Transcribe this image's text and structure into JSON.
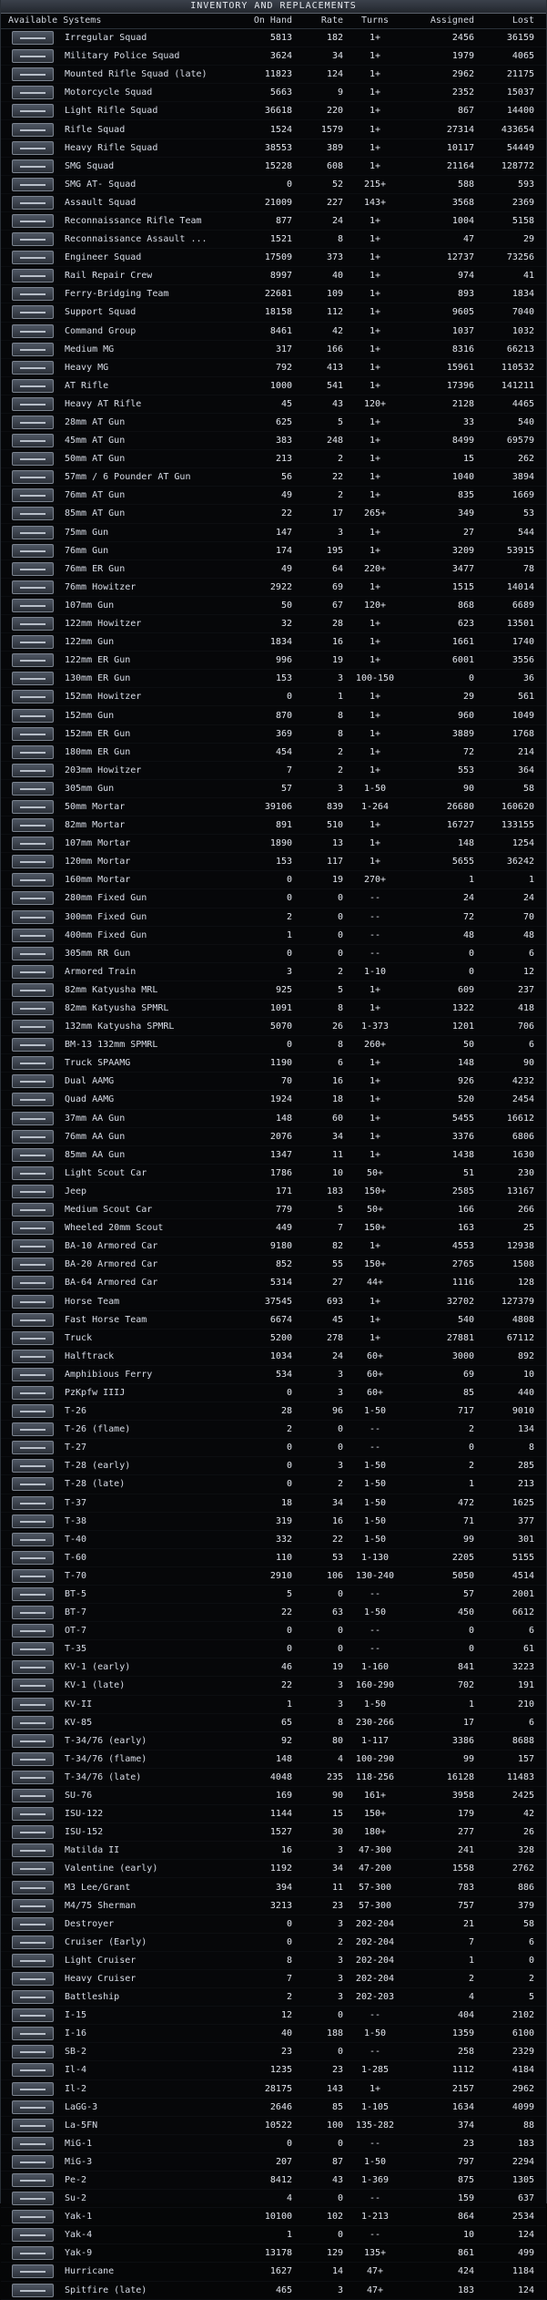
{
  "window": {
    "title": "INVENTORY AND REPLACEMENTS"
  },
  "header": {
    "systems": "Available Systems",
    "on_hand": "On Hand",
    "rate": "Rate",
    "turns": "Turns",
    "assigned": "Assigned",
    "lost": "Lost"
  },
  "rows": [
    {
      "name": "Irregular Squad",
      "on_hand": "5813",
      "rate": "182",
      "turns": "1+",
      "assigned": "2456",
      "lost": "36159"
    },
    {
      "name": "Military Police Squad",
      "on_hand": "3624",
      "rate": "34",
      "turns": "1+",
      "assigned": "1979",
      "lost": "4065"
    },
    {
      "name": "Mounted Rifle Squad (late)",
      "on_hand": "11823",
      "rate": "124",
      "turns": "1+",
      "assigned": "2962",
      "lost": "21175"
    },
    {
      "name": "Motorcycle Squad",
      "on_hand": "5663",
      "rate": "9",
      "turns": "1+",
      "assigned": "2352",
      "lost": "15037"
    },
    {
      "name": "Light Rifle Squad",
      "on_hand": "36618",
      "rate": "220",
      "turns": "1+",
      "assigned": "867",
      "lost": "14400"
    },
    {
      "name": "Rifle Squad",
      "on_hand": "1524",
      "rate": "1579",
      "turns": "1+",
      "assigned": "27314",
      "lost": "433654"
    },
    {
      "name": "Heavy Rifle Squad",
      "on_hand": "38553",
      "rate": "389",
      "turns": "1+",
      "assigned": "10117",
      "lost": "54449"
    },
    {
      "name": "SMG Squad",
      "on_hand": "15228",
      "rate": "608",
      "turns": "1+",
      "assigned": "21164",
      "lost": "128772"
    },
    {
      "name": "SMG AT- Squad",
      "on_hand": "0",
      "rate": "52",
      "turns": "215+",
      "assigned": "588",
      "lost": "593"
    },
    {
      "name": "Assault Squad",
      "on_hand": "21009",
      "rate": "227",
      "turns": "143+",
      "assigned": "3568",
      "lost": "2369"
    },
    {
      "name": "Reconnaissance Rifle Team",
      "on_hand": "877",
      "rate": "24",
      "turns": "1+",
      "assigned": "1004",
      "lost": "5158"
    },
    {
      "name": "Reconnaissance Assault ...",
      "on_hand": "1521",
      "rate": "8",
      "turns": "1+",
      "assigned": "47",
      "lost": "29"
    },
    {
      "name": "Engineer Squad",
      "on_hand": "17509",
      "rate": "373",
      "turns": "1+",
      "assigned": "12737",
      "lost": "73256"
    },
    {
      "name": "Rail Repair Crew",
      "on_hand": "8997",
      "rate": "40",
      "turns": "1+",
      "assigned": "974",
      "lost": "41"
    },
    {
      "name": "Ferry-Bridging Team",
      "on_hand": "22681",
      "rate": "109",
      "turns": "1+",
      "assigned": "893",
      "lost": "1834"
    },
    {
      "name": "Support Squad",
      "on_hand": "18158",
      "rate": "112",
      "turns": "1+",
      "assigned": "9605",
      "lost": "7040"
    },
    {
      "name": "Command Group",
      "on_hand": "8461",
      "rate": "42",
      "turns": "1+",
      "assigned": "1037",
      "lost": "1032"
    },
    {
      "name": "Medium MG",
      "on_hand": "317",
      "rate": "166",
      "turns": "1+",
      "assigned": "8316",
      "lost": "66213"
    },
    {
      "name": "Heavy MG",
      "on_hand": "792",
      "rate": "413",
      "turns": "1+",
      "assigned": "15961",
      "lost": "110532"
    },
    {
      "name": "AT Rifle",
      "on_hand": "1000",
      "rate": "541",
      "turns": "1+",
      "assigned": "17396",
      "lost": "141211"
    },
    {
      "name": "Heavy AT Rifle",
      "on_hand": "45",
      "rate": "43",
      "turns": "120+",
      "assigned": "2128",
      "lost": "4465"
    },
    {
      "name": "28mm AT Gun",
      "on_hand": "625",
      "rate": "5",
      "turns": "1+",
      "assigned": "33",
      "lost": "540"
    },
    {
      "name": "45mm AT Gun",
      "on_hand": "383",
      "rate": "248",
      "turns": "1+",
      "assigned": "8499",
      "lost": "69579"
    },
    {
      "name": "50mm AT Gun",
      "on_hand": "213",
      "rate": "2",
      "turns": "1+",
      "assigned": "15",
      "lost": "262"
    },
    {
      "name": "57mm / 6 Pounder AT Gun",
      "on_hand": "56",
      "rate": "22",
      "turns": "1+",
      "assigned": "1040",
      "lost": "3894"
    },
    {
      "name": "76mm AT Gun",
      "on_hand": "49",
      "rate": "2",
      "turns": "1+",
      "assigned": "835",
      "lost": "1669"
    },
    {
      "name": "85mm AT Gun",
      "on_hand": "22",
      "rate": "17",
      "turns": "265+",
      "assigned": "349",
      "lost": "53"
    },
    {
      "name": "75mm Gun",
      "on_hand": "147",
      "rate": "3",
      "turns": "1+",
      "assigned": "27",
      "lost": "544"
    },
    {
      "name": "76mm Gun",
      "on_hand": "174",
      "rate": "195",
      "turns": "1+",
      "assigned": "3209",
      "lost": "53915"
    },
    {
      "name": "76mm ER Gun",
      "on_hand": "49",
      "rate": "64",
      "turns": "220+",
      "assigned": "3477",
      "lost": "78"
    },
    {
      "name": "76mm Howitzer",
      "on_hand": "2922",
      "rate": "69",
      "turns": "1+",
      "assigned": "1515",
      "lost": "14014"
    },
    {
      "name": "107mm Gun",
      "on_hand": "50",
      "rate": "67",
      "turns": "120+",
      "assigned": "868",
      "lost": "6689"
    },
    {
      "name": "122mm Howitzer",
      "on_hand": "32",
      "rate": "28",
      "turns": "1+",
      "assigned": "623",
      "lost": "13501"
    },
    {
      "name": "122mm Gun",
      "on_hand": "1834",
      "rate": "16",
      "turns": "1+",
      "assigned": "1661",
      "lost": "1740"
    },
    {
      "name": "122mm ER Gun",
      "on_hand": "996",
      "rate": "19",
      "turns": "1+",
      "assigned": "6001",
      "lost": "3556"
    },
    {
      "name": "130mm ER Gun",
      "on_hand": "153",
      "rate": "3",
      "turns": "100-150",
      "assigned": "0",
      "lost": "36"
    },
    {
      "name": "152mm Howitzer",
      "on_hand": "0",
      "rate": "1",
      "turns": "1+",
      "assigned": "29",
      "lost": "561"
    },
    {
      "name": "152mm Gun",
      "on_hand": "870",
      "rate": "8",
      "turns": "1+",
      "assigned": "960",
      "lost": "1049"
    },
    {
      "name": "152mm ER Gun",
      "on_hand": "369",
      "rate": "8",
      "turns": "1+",
      "assigned": "3889",
      "lost": "1768"
    },
    {
      "name": "180mm ER Gun",
      "on_hand": "454",
      "rate": "2",
      "turns": "1+",
      "assigned": "72",
      "lost": "214"
    },
    {
      "name": "203mm Howitzer",
      "on_hand": "7",
      "rate": "2",
      "turns": "1+",
      "assigned": "553",
      "lost": "364"
    },
    {
      "name": "305mm Gun",
      "on_hand": "57",
      "rate": "3",
      "turns": "1-50",
      "assigned": "90",
      "lost": "58"
    },
    {
      "name": "50mm Mortar",
      "on_hand": "39106",
      "rate": "839",
      "turns": "1-264",
      "assigned": "26680",
      "lost": "160620"
    },
    {
      "name": "82mm Mortar",
      "on_hand": "891",
      "rate": "510",
      "turns": "1+",
      "assigned": "16727",
      "lost": "133155"
    },
    {
      "name": "107mm Mortar",
      "on_hand": "1890",
      "rate": "13",
      "turns": "1+",
      "assigned": "148",
      "lost": "1254"
    },
    {
      "name": "120mm Mortar",
      "on_hand": "153",
      "rate": "117",
      "turns": "1+",
      "assigned": "5655",
      "lost": "36242"
    },
    {
      "name": "160mm Mortar",
      "on_hand": "0",
      "rate": "19",
      "turns": "270+",
      "assigned": "1",
      "lost": "1"
    },
    {
      "name": "280mm Fixed Gun",
      "on_hand": "0",
      "rate": "0",
      "turns": "--",
      "assigned": "24",
      "lost": "24"
    },
    {
      "name": "300mm Fixed Gun",
      "on_hand": "2",
      "rate": "0",
      "turns": "--",
      "assigned": "72",
      "lost": "70"
    },
    {
      "name": "400mm Fixed Gun",
      "on_hand": "1",
      "rate": "0",
      "turns": "--",
      "assigned": "48",
      "lost": "48"
    },
    {
      "name": "305mm RR Gun",
      "on_hand": "0",
      "rate": "0",
      "turns": "--",
      "assigned": "0",
      "lost": "6"
    },
    {
      "name": "Armored Train",
      "on_hand": "3",
      "rate": "2",
      "turns": "1-10",
      "assigned": "0",
      "lost": "12"
    },
    {
      "name": "82mm Katyusha MRL",
      "on_hand": "925",
      "rate": "5",
      "turns": "1+",
      "assigned": "609",
      "lost": "237"
    },
    {
      "name": "82mm Katyusha SPMRL",
      "on_hand": "1091",
      "rate": "8",
      "turns": "1+",
      "assigned": "1322",
      "lost": "418"
    },
    {
      "name": "132mm Katyusha SPMRL",
      "on_hand": "5070",
      "rate": "26",
      "turns": "1-373",
      "assigned": "1201",
      "lost": "706"
    },
    {
      "name": "BM-13 132mm SPMRL",
      "on_hand": "0",
      "rate": "8",
      "turns": "260+",
      "assigned": "50",
      "lost": "6"
    },
    {
      "name": "Truck SPAAMG",
      "on_hand": "1190",
      "rate": "6",
      "turns": "1+",
      "assigned": "148",
      "lost": "90"
    },
    {
      "name": "Dual AAMG",
      "on_hand": "70",
      "rate": "16",
      "turns": "1+",
      "assigned": "926",
      "lost": "4232"
    },
    {
      "name": "Quad AAMG",
      "on_hand": "1924",
      "rate": "18",
      "turns": "1+",
      "assigned": "520",
      "lost": "2454"
    },
    {
      "name": "37mm AA Gun",
      "on_hand": "148",
      "rate": "60",
      "turns": "1+",
      "assigned": "5455",
      "lost": "16612"
    },
    {
      "name": "76mm AA Gun",
      "on_hand": "2076",
      "rate": "34",
      "turns": "1+",
      "assigned": "3376",
      "lost": "6806"
    },
    {
      "name": "85mm AA Gun",
      "on_hand": "1347",
      "rate": "11",
      "turns": "1+",
      "assigned": "1438",
      "lost": "1630"
    },
    {
      "name": "Light Scout Car",
      "on_hand": "1786",
      "rate": "10",
      "turns": "50+",
      "assigned": "51",
      "lost": "230"
    },
    {
      "name": "Jeep",
      "on_hand": "171",
      "rate": "183",
      "turns": "150+",
      "assigned": "2585",
      "lost": "13167"
    },
    {
      "name": "Medium Scout Car",
      "on_hand": "779",
      "rate": "5",
      "turns": "50+",
      "assigned": "166",
      "lost": "266"
    },
    {
      "name": "Wheeled 20mm Scout",
      "on_hand": "449",
      "rate": "7",
      "turns": "150+",
      "assigned": "163",
      "lost": "25"
    },
    {
      "name": "BA-10 Armored Car",
      "on_hand": "9180",
      "rate": "82",
      "turns": "1+",
      "assigned": "4553",
      "lost": "12938"
    },
    {
      "name": "BA-20 Armored Car",
      "on_hand": "852",
      "rate": "55",
      "turns": "150+",
      "assigned": "2765",
      "lost": "1508"
    },
    {
      "name": "BA-64 Armored Car",
      "on_hand": "5314",
      "rate": "27",
      "turns": "44+",
      "assigned": "1116",
      "lost": "128"
    },
    {
      "name": "Horse Team",
      "on_hand": "37545",
      "rate": "693",
      "turns": "1+",
      "assigned": "32702",
      "lost": "127379"
    },
    {
      "name": "Fast Horse Team",
      "on_hand": "6674",
      "rate": "45",
      "turns": "1+",
      "assigned": "540",
      "lost": "4808"
    },
    {
      "name": "Truck",
      "on_hand": "5200",
      "rate": "278",
      "turns": "1+",
      "assigned": "27881",
      "lost": "67112"
    },
    {
      "name": "Halftrack",
      "on_hand": "1034",
      "rate": "24",
      "turns": "60+",
      "assigned": "3000",
      "lost": "892"
    },
    {
      "name": "Amphibious Ferry",
      "on_hand": "534",
      "rate": "3",
      "turns": "60+",
      "assigned": "69",
      "lost": "10"
    },
    {
      "name": "PzKpfw IIIJ",
      "on_hand": "0",
      "rate": "3",
      "turns": "60+",
      "assigned": "85",
      "lost": "440"
    },
    {
      "name": "T-26",
      "on_hand": "28",
      "rate": "96",
      "turns": "1-50",
      "assigned": "717",
      "lost": "9010"
    },
    {
      "name": "T-26 (flame)",
      "on_hand": "2",
      "rate": "0",
      "turns": "--",
      "assigned": "2",
      "lost": "134"
    },
    {
      "name": "T-27",
      "on_hand": "0",
      "rate": "0",
      "turns": "--",
      "assigned": "0",
      "lost": "8"
    },
    {
      "name": "T-28 (early)",
      "on_hand": "0",
      "rate": "3",
      "turns": "1-50",
      "assigned": "2",
      "lost": "285"
    },
    {
      "name": "T-28 (late)",
      "on_hand": "0",
      "rate": "2",
      "turns": "1-50",
      "assigned": "1",
      "lost": "213"
    },
    {
      "name": "T-37",
      "on_hand": "18",
      "rate": "34",
      "turns": "1-50",
      "assigned": "472",
      "lost": "1625"
    },
    {
      "name": "T-38",
      "on_hand": "319",
      "rate": "16",
      "turns": "1-50",
      "assigned": "71",
      "lost": "377"
    },
    {
      "name": "T-40",
      "on_hand": "332",
      "rate": "22",
      "turns": "1-50",
      "assigned": "99",
      "lost": "301"
    },
    {
      "name": "T-60",
      "on_hand": "110",
      "rate": "53",
      "turns": "1-130",
      "assigned": "2205",
      "lost": "5155"
    },
    {
      "name": "T-70",
      "on_hand": "2910",
      "rate": "106",
      "turns": "130-240",
      "assigned": "5050",
      "lost": "4514"
    },
    {
      "name": "BT-5",
      "on_hand": "5",
      "rate": "0",
      "turns": "--",
      "assigned": "57",
      "lost": "2001"
    },
    {
      "name": "BT-7",
      "on_hand": "22",
      "rate": "63",
      "turns": "1-50",
      "assigned": "450",
      "lost": "6612"
    },
    {
      "name": "OT-7",
      "on_hand": "0",
      "rate": "0",
      "turns": "--",
      "assigned": "0",
      "lost": "6"
    },
    {
      "name": "T-35",
      "on_hand": "0",
      "rate": "0",
      "turns": "--",
      "assigned": "0",
      "lost": "61"
    },
    {
      "name": "KV-1 (early)",
      "on_hand": "46",
      "rate": "19",
      "turns": "1-160",
      "assigned": "841",
      "lost": "3223"
    },
    {
      "name": "KV-1 (late)",
      "on_hand": "22",
      "rate": "3",
      "turns": "160-290",
      "assigned": "702",
      "lost": "191"
    },
    {
      "name": "KV-II",
      "on_hand": "1",
      "rate": "3",
      "turns": "1-50",
      "assigned": "1",
      "lost": "210"
    },
    {
      "name": "KV-85",
      "on_hand": "65",
      "rate": "8",
      "turns": "230-266",
      "assigned": "17",
      "lost": "6"
    },
    {
      "name": "T-34/76 (early)",
      "on_hand": "92",
      "rate": "80",
      "turns": "1-117",
      "assigned": "3386",
      "lost": "8688"
    },
    {
      "name": "T-34/76 (flame)",
      "on_hand": "148",
      "rate": "4",
      "turns": "100-290",
      "assigned": "99",
      "lost": "157"
    },
    {
      "name": "T-34/76 (late)",
      "on_hand": "4048",
      "rate": "235",
      "turns": "118-256",
      "assigned": "16128",
      "lost": "11483"
    },
    {
      "name": "SU-76",
      "on_hand": "169",
      "rate": "90",
      "turns": "161+",
      "assigned": "3958",
      "lost": "2425"
    },
    {
      "name": "ISU-122",
      "on_hand": "1144",
      "rate": "15",
      "turns": "150+",
      "assigned": "179",
      "lost": "42"
    },
    {
      "name": "ISU-152",
      "on_hand": "1527",
      "rate": "30",
      "turns": "180+",
      "assigned": "277",
      "lost": "26"
    },
    {
      "name": "Matilda II",
      "on_hand": "16",
      "rate": "3",
      "turns": "47-300",
      "assigned": "241",
      "lost": "328"
    },
    {
      "name": "Valentine (early)",
      "on_hand": "1192",
      "rate": "34",
      "turns": "47-200",
      "assigned": "1558",
      "lost": "2762"
    },
    {
      "name": "M3 Lee/Grant",
      "on_hand": "394",
      "rate": "11",
      "turns": "57-300",
      "assigned": "783",
      "lost": "886"
    },
    {
      "name": "M4/75 Sherman",
      "on_hand": "3213",
      "rate": "23",
      "turns": "57-300",
      "assigned": "757",
      "lost": "379"
    },
    {
      "name": "Destroyer",
      "on_hand": "0",
      "rate": "3",
      "turns": "202-204",
      "assigned": "21",
      "lost": "58"
    },
    {
      "name": "Cruiser (Early)",
      "on_hand": "0",
      "rate": "2",
      "turns": "202-204",
      "assigned": "7",
      "lost": "6"
    },
    {
      "name": "Light Cruiser",
      "on_hand": "8",
      "rate": "3",
      "turns": "202-204",
      "assigned": "1",
      "lost": "0"
    },
    {
      "name": "Heavy Cruiser",
      "on_hand": "7",
      "rate": "3",
      "turns": "202-204",
      "assigned": "2",
      "lost": "2"
    },
    {
      "name": "Battleship",
      "on_hand": "2",
      "rate": "3",
      "turns": "202-203",
      "assigned": "4",
      "lost": "5"
    },
    {
      "name": "I-15",
      "on_hand": "12",
      "rate": "0",
      "turns": "--",
      "assigned": "404",
      "lost": "2102"
    },
    {
      "name": "I-16",
      "on_hand": "40",
      "rate": "188",
      "turns": "1-50",
      "assigned": "1359",
      "lost": "6100"
    },
    {
      "name": "SB-2",
      "on_hand": "23",
      "rate": "0",
      "turns": "--",
      "assigned": "258",
      "lost": "2329"
    },
    {
      "name": "Il-4",
      "on_hand": "1235",
      "rate": "23",
      "turns": "1-285",
      "assigned": "1112",
      "lost": "4184"
    },
    {
      "name": "Il-2",
      "on_hand": "28175",
      "rate": "143",
      "turns": "1+",
      "assigned": "2157",
      "lost": "2962"
    },
    {
      "name": "LaGG-3",
      "on_hand": "2646",
      "rate": "85",
      "turns": "1-105",
      "assigned": "1634",
      "lost": "4099"
    },
    {
      "name": "La-5FN",
      "on_hand": "10522",
      "rate": "100",
      "turns": "135-282",
      "assigned": "374",
      "lost": "88"
    },
    {
      "name": "MiG-1",
      "on_hand": "0",
      "rate": "0",
      "turns": "--",
      "assigned": "23",
      "lost": "183"
    },
    {
      "name": "MiG-3",
      "on_hand": "207",
      "rate": "87",
      "turns": "1-50",
      "assigned": "797",
      "lost": "2294"
    },
    {
      "name": "Pe-2",
      "on_hand": "8412",
      "rate": "43",
      "turns": "1-369",
      "assigned": "875",
      "lost": "1305"
    },
    {
      "name": "Su-2",
      "on_hand": "4",
      "rate": "0",
      "turns": "--",
      "assigned": "159",
      "lost": "637"
    },
    {
      "name": "Yak-1",
      "on_hand": "10100",
      "rate": "102",
      "turns": "1-213",
      "assigned": "864",
      "lost": "2534"
    },
    {
      "name": "Yak-4",
      "on_hand": "1",
      "rate": "0",
      "turns": "--",
      "assigned": "10",
      "lost": "124"
    },
    {
      "name": "Yak-9",
      "on_hand": "13178",
      "rate": "129",
      "turns": "135+",
      "assigned": "861",
      "lost": "499"
    },
    {
      "name": "Hurricane",
      "on_hand": "1627",
      "rate": "14",
      "turns": "47+",
      "assigned": "424",
      "lost": "1184"
    },
    {
      "name": "Spitfire (late)",
      "on_hand": "465",
      "rate": "3",
      "turns": "47+",
      "assigned": "183",
      "lost": "124"
    }
  ]
}
